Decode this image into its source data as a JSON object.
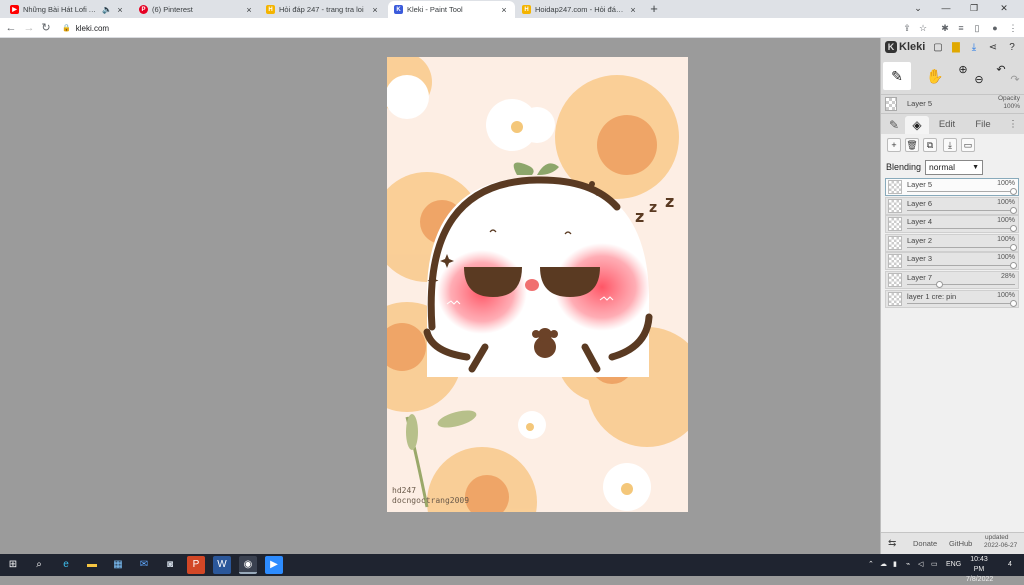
{
  "browser": {
    "tabs": [
      {
        "title": "Những Bài Hát Lofi Acoustic",
        "favicon": "youtube-icon",
        "color": "#ff0000",
        "audio": true
      },
      {
        "title": "(6) Pinterest",
        "favicon": "pinterest-icon",
        "color": "#e60023"
      },
      {
        "title": "Hỏi đáp 247 - trang tra loi",
        "favicon": "hoidap-icon",
        "color": "#f4b400"
      },
      {
        "title": "Kleki - Paint Tool",
        "favicon": "kleki-icon",
        "color": "#3b5bdb",
        "active": true
      },
      {
        "title": "Hoidap247.com - Hỏi đáp bài tậ...",
        "favicon": "hoidap-icon",
        "color": "#f4b400"
      }
    ],
    "close_glyph": "×",
    "new_tab": "+",
    "window_controls": {
      "minimize": "—",
      "maximize": "❐",
      "close": "✕",
      "menu": "⌄"
    },
    "url": "kleki.com"
  },
  "canvas_signature": {
    "line1": "hd247",
    "line2": "docngoctrang2009"
  },
  "kleki": {
    "logo": "Kleki",
    "current_layer": {
      "name": "Layer 5",
      "opacity_label": "Opacity",
      "opacity": "100%"
    },
    "tabs": {
      "edit": "Edit",
      "file": "File"
    },
    "blending_label": "Blending",
    "blending_value": "normal",
    "layers": [
      {
        "name": "Layer 5",
        "pct": "100%",
        "opacity": 1.0,
        "selected": true
      },
      {
        "name": "Layer 6",
        "pct": "100%",
        "opacity": 1.0
      },
      {
        "name": "Layer 4",
        "pct": "100%",
        "opacity": 1.0
      },
      {
        "name": "Layer 2",
        "pct": "100%",
        "opacity": 1.0
      },
      {
        "name": "Layer 3",
        "pct": "100%",
        "opacity": 1.0
      },
      {
        "name": "Layer 7",
        "pct": "28%",
        "opacity": 0.28
      },
      {
        "name": "layer 1 cre: pin",
        "pct": "100%",
        "opacity": 1.0
      }
    ],
    "footer": {
      "donate": "Donate",
      "github": "GitHub",
      "updated_label": "updated",
      "updated_date": "2022-06-27"
    }
  },
  "taskbar": {
    "time": "10:43 PM",
    "date": "7/8/2022",
    "lang": "ENG",
    "notifications": "4"
  }
}
